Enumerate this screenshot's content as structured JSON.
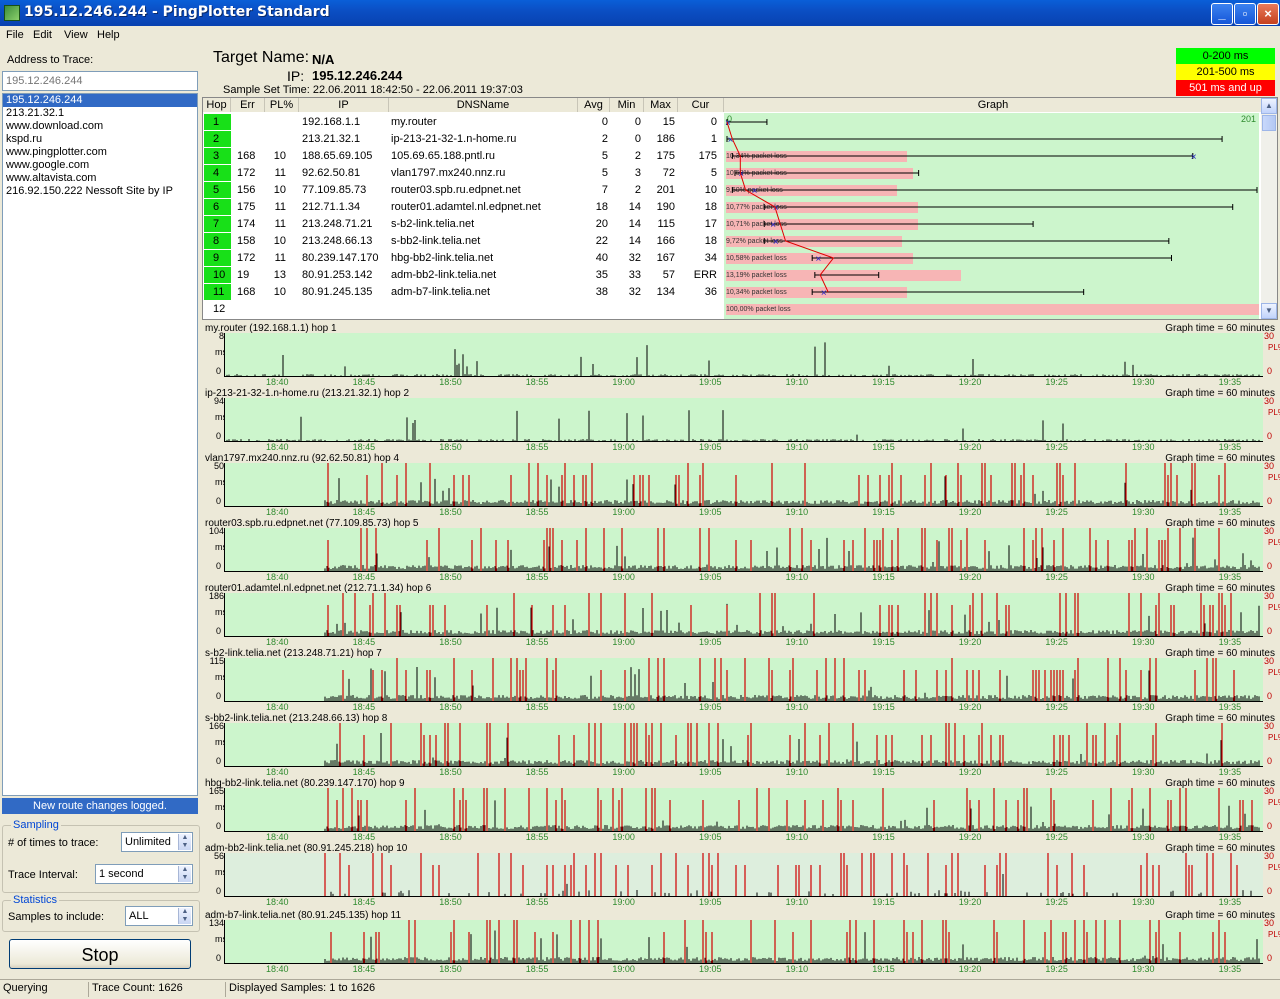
{
  "window": {
    "title": "195.12.246.244 - PingPlotter Standard",
    "minimize": "_",
    "maximize": "▫",
    "close": "×"
  },
  "menu": [
    "File",
    "Edit",
    "View",
    "Help"
  ],
  "left": {
    "address_label": "Address to Trace:",
    "address_placeholder": "195.12.246.244",
    "hosts": [
      "195.12.246.244",
      "213.21.32.1",
      "www.download.com",
      "kspd.ru",
      "www.pingplotter.com",
      "www.google.com",
      "www.altavista.com",
      "216.92.150.222 Nessoft Site by IP"
    ],
    "route_changes": "New route changes logged.",
    "sampling": {
      "title": "Sampling",
      "times_label": "# of times to trace:",
      "times_value": "Unlimited",
      "interval_label": "Trace Interval:",
      "interval_value": "1 second"
    },
    "statistics": {
      "title": "Statistics",
      "samples_label": "Samples to include:",
      "samples_value": "ALL"
    },
    "stop": "Stop"
  },
  "status": {
    "state": "Querying",
    "trace_count": "Trace Count: 1626",
    "displayed": "Displayed Samples: 1 to 1626"
  },
  "header": {
    "target_label": "Target Name:",
    "target_value": "N/A",
    "ip_label": "IP:",
    "ip_value": "195.12.246.244",
    "sample_set": "Sample Set Time:  22.06.2011 18:42:50 - 22.06.2011 19:37:03"
  },
  "legend": [
    {
      "label": "0-200 ms",
      "bg": "#00ff00",
      "fg": "#000000"
    },
    {
      "label": "201-500 ms",
      "bg": "#ffff00",
      "fg": "#000000"
    },
    {
      "label": "501 ms and up",
      "bg": "#ff0000",
      "fg": "#ffffff"
    }
  ],
  "table": {
    "columns": [
      "Hop",
      "Err",
      "PL%",
      "IP",
      "DNSName",
      "Avg",
      "Min",
      "Max",
      "Cur",
      "Graph"
    ],
    "graph_scale_left": "0",
    "graph_scale_right": "201",
    "rows": [
      {
        "hop": "1",
        "err": "",
        "pl": "",
        "ip": "192.168.1.1",
        "dns": "my.router",
        "avg": "0",
        "min": "0",
        "max": "15",
        "cur": "0",
        "loss": "",
        "lossf": 0
      },
      {
        "hop": "2",
        "err": "",
        "pl": "",
        "ip": "213.21.32.1",
        "dns": "ip-213-21-32-1.n-home.ru",
        "avg": "2",
        "min": "0",
        "max": "186",
        "cur": "1",
        "loss": "",
        "lossf": 0
      },
      {
        "hop": "3",
        "err": "168",
        "pl": "10",
        "ip": "188.65.69.105",
        "dns": "105.69.65.188.pntl.ru",
        "avg": "5",
        "min": "2",
        "max": "175",
        "cur": "175",
        "loss": "10,34% packet loss",
        "lossf": 0.34
      },
      {
        "hop": "4",
        "err": "172",
        "pl": "11",
        "ip": "92.62.50.81",
        "dns": "vlan1797.mx240.nnz.ru",
        "avg": "5",
        "min": "3",
        "max": "72",
        "cur": "5",
        "loss": "10,58% packet loss",
        "lossf": 0.35
      },
      {
        "hop": "5",
        "err": "156",
        "pl": "10",
        "ip": "77.109.85.73",
        "dns": "router03.spb.ru.edpnet.net",
        "avg": "7",
        "min": "2",
        "max": "201",
        "cur": "10",
        "loss": "9,60% packet loss",
        "lossf": 0.32
      },
      {
        "hop": "6",
        "err": "175",
        "pl": "11",
        "ip": "212.71.1.34",
        "dns": "router01.adamtel.nl.edpnet.net",
        "avg": "18",
        "min": "14",
        "max": "190",
        "cur": "18",
        "loss": "10,77% packet loss",
        "lossf": 0.36
      },
      {
        "hop": "7",
        "err": "174",
        "pl": "11",
        "ip": "213.248.71.21",
        "dns": "s-b2-link.telia.net",
        "avg": "20",
        "min": "14",
        "max": "115",
        "cur": "17",
        "loss": "10,71% packet loss",
        "lossf": 0.36
      },
      {
        "hop": "8",
        "err": "158",
        "pl": "10",
        "ip": "213.248.66.13",
        "dns": "s-bb2-link.telia.net",
        "avg": "22",
        "min": "14",
        "max": "166",
        "cur": "18",
        "loss": "9,72% packet loss",
        "lossf": 0.33
      },
      {
        "hop": "9",
        "err": "172",
        "pl": "11",
        "ip": "80.239.147.170",
        "dns": "hbg-bb2-link.telia.net",
        "avg": "40",
        "min": "32",
        "max": "167",
        "cur": "34",
        "loss": "10,58% packet loss",
        "lossf": 0.35
      },
      {
        "hop": "10",
        "err": "19",
        "pl": "13",
        "ip": "80.91.253.142",
        "dns": "adm-bb2-link.telia.net",
        "avg": "35",
        "min": "33",
        "max": "57",
        "cur": "ERR",
        "loss": "13,19% packet loss",
        "lossf": 0.44
      },
      {
        "hop": "11",
        "err": "168",
        "pl": "10",
        "ip": "80.91.245.135",
        "dns": "adm-b7-link.telia.net",
        "avg": "38",
        "min": "32",
        "max": "134",
        "cur": "36",
        "loss": "10,34% packet loss",
        "lossf": 0.34
      },
      {
        "hop": "12",
        "err": "",
        "pl": "",
        "ip": "",
        "dns": "",
        "avg": "",
        "min": "",
        "max": "",
        "cur": "",
        "loss": "100,00% packet loss",
        "lossf": 1.0
      }
    ]
  },
  "timegraphs": {
    "time_label": "Graph time = 60 minutes",
    "ms_label": "ms",
    "zero": "0",
    "pl_top": "30",
    "pl_label": "PL%",
    "ticks": [
      "18:40",
      "18:45",
      "18:50",
      "18:55",
      "19:00",
      "19:05",
      "19:10",
      "19:15",
      "19:20",
      "19:25",
      "19:30",
      "19:35"
    ],
    "graphs": [
      {
        "label": "my.router (192.168.1.1) hop 1",
        "ymax": "8",
        "loss": false
      },
      {
        "label": "ip-213-21-32-1.n-home.ru (213.21.32.1) hop 2",
        "ymax": "94",
        "loss": false
      },
      {
        "label": "vlan1797.mx240.nnz.ru (92.62.50.81) hop 4",
        "ymax": "50",
        "loss": true
      },
      {
        "label": "router03.spb.ru.edpnet.net (77.109.85.73) hop 5",
        "ymax": "104",
        "loss": true
      },
      {
        "label": "router01.adamtel.nl.edpnet.net (212.71.1.34) hop 6",
        "ymax": "186",
        "loss": true
      },
      {
        "label": "s-b2-link.telia.net (213.248.71.21) hop 7",
        "ymax": "115",
        "loss": true
      },
      {
        "label": "s-bb2-link.telia.net (213.248.66.13) hop 8",
        "ymax": "166",
        "loss": true
      },
      {
        "label": "hbg-bb2-link.telia.net (80.239.147.170) hop 9",
        "ymax": "165",
        "loss": true
      },
      {
        "label": "adm-bb2-link.telia.net (80.91.245.218) hop 10",
        "ymax": "56",
        "loss": true,
        "sparse": true
      },
      {
        "label": "adm-b7-link.telia.net (80.91.245.135) hop 11",
        "ymax": "134",
        "loss": true
      }
    ]
  }
}
